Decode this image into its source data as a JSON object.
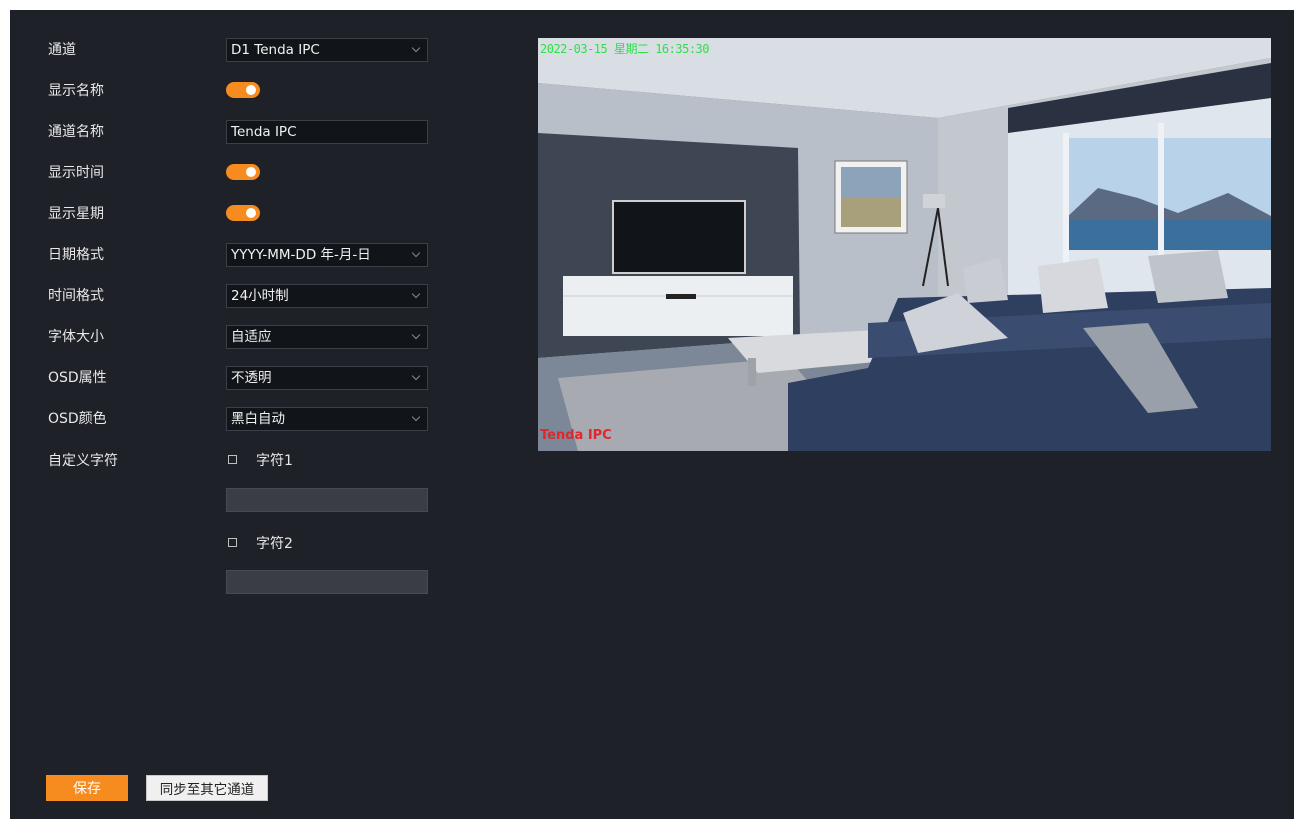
{
  "form": {
    "channel": {
      "label": "通道",
      "value": "D1 Tenda IPC"
    },
    "show_name": {
      "label": "显示名称",
      "on": true
    },
    "channel_name": {
      "label": "通道名称",
      "value": "Tenda IPC"
    },
    "show_time": {
      "label": "显示时间",
      "on": true
    },
    "show_week": {
      "label": "显示星期",
      "on": true
    },
    "date_format": {
      "label": "日期格式",
      "value": "YYYY-MM-DD 年-月-日"
    },
    "time_format": {
      "label": "时间格式",
      "value": "24小时制"
    },
    "font_size": {
      "label": "字体大小",
      "value": "自适应"
    },
    "osd_attr": {
      "label": "OSD属性",
      "value": "不透明"
    },
    "osd_color": {
      "label": "OSD颜色",
      "value": "黑白自动"
    },
    "custom_chars": {
      "label": "自定义字符",
      "char1": {
        "label": "字符1",
        "checked": false,
        "value": ""
      },
      "char2": {
        "label": "字符2",
        "checked": false,
        "value": ""
      }
    }
  },
  "preview": {
    "osd_time_text": "2022-03-15 星期二 16:35:30",
    "osd_name_text": "Tenda IPC"
  },
  "buttons": {
    "save": "保存",
    "sync": "同步至其它通道"
  },
  "colors": {
    "accent": "#f68b1f",
    "background": "#1f2128",
    "osd_time": "#2fe04a",
    "osd_name": "#e0272b"
  }
}
